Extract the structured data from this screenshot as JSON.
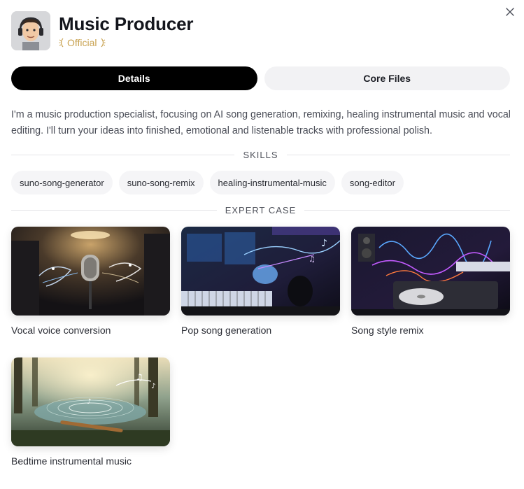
{
  "header": {
    "title": "Music Producer",
    "badge": "Official"
  },
  "tabs": [
    {
      "label": "Details",
      "active": true
    },
    {
      "label": "Core Files",
      "active": false
    }
  ],
  "description": "I'm a music production specialist, focusing on AI song generation, remixing, healing instrumental music and vocal editing. I'll turn your ideas into finished, emotional and listenable tracks with professional polish.",
  "sections": {
    "skills": "SKILLS",
    "cases": "EXPERT CASE"
  },
  "skills": [
    "suno-song-generator",
    "suno-song-remix",
    "healing-instrumental-music",
    "song-editor"
  ],
  "cases": [
    {
      "caption": "Vocal voice conversion"
    },
    {
      "caption": "Pop song generation"
    },
    {
      "caption": "Song style remix"
    },
    {
      "caption": "Bedtime instrumental music"
    }
  ],
  "colors": {
    "badge": "#c9a352",
    "active_tab": "#000000",
    "inactive_tab": "#f2f2f4",
    "chip_bg": "#f5f5f7"
  },
  "icons": {
    "close": "close-icon",
    "laurel": "laurel-icon"
  }
}
